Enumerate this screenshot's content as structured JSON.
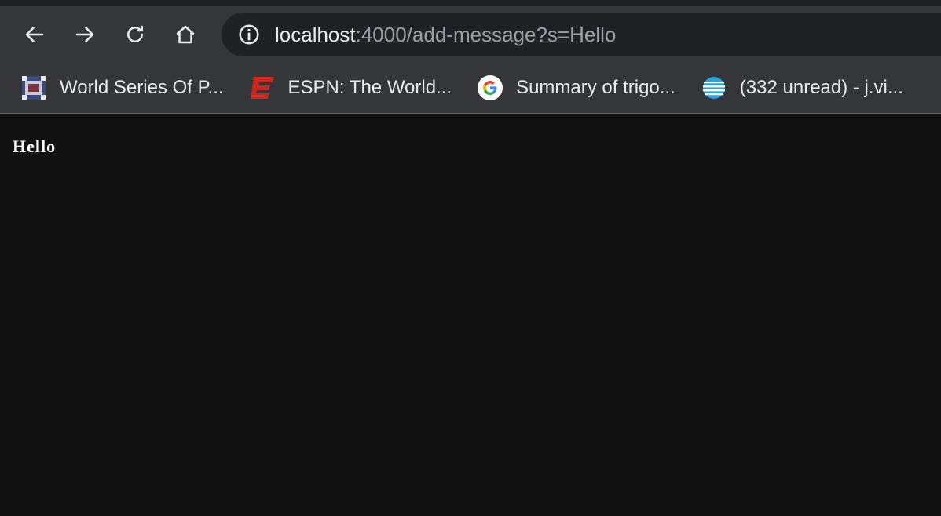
{
  "browser": {
    "address_bar": {
      "host": "localhost",
      "path": ":4000/add-message?s=Hello"
    },
    "nav_icons": [
      "back-arrow-icon",
      "forward-arrow-icon",
      "reload-icon",
      "home-icon"
    ],
    "bookmarks": [
      {
        "label": "World Series Of P...",
        "icon": "wsop-favicon"
      },
      {
        "label": "ESPN: The World...",
        "icon": "espn-favicon"
      },
      {
        "label": "Summary of trigo...",
        "icon": "google-favicon"
      },
      {
        "label": "(332 unread) - j.vi...",
        "icon": "att-favicon"
      }
    ]
  },
  "page": {
    "message": "Hello"
  },
  "colors": {
    "toolbar": "#35363a",
    "omnibox": "#202124",
    "page_bg": "#121212",
    "espn_red": "#c8281e",
    "att_blue": "#2aa2e0"
  }
}
